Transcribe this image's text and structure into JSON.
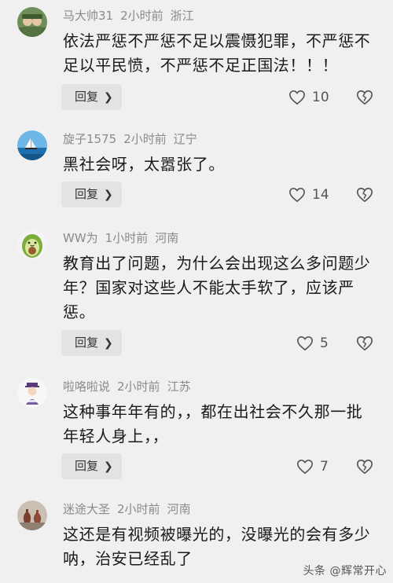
{
  "comments": [
    {
      "username": "马大帅31",
      "time": "2小时前",
      "location": "浙江",
      "avatar_icon": "soldiers-avatar-icon",
      "text": "依法严惩不严惩不足以震慑犯罪，不严惩不足以平民愤，不严惩不足正国法！！！",
      "reply_label": "回复",
      "likes": "10"
    },
    {
      "username": "旋子1575",
      "time": "2小时前",
      "location": "辽宁",
      "avatar_icon": "seascape-avatar-icon",
      "text": "黑社会呀，太嚣张了。",
      "reply_label": "回复",
      "likes": "14"
    },
    {
      "username": "WW为",
      "time": "1小时前",
      "location": "河南",
      "avatar_icon": "avocado-avatar-icon",
      "text": "教育出了问题，为什么会出现这么多问题少年？国家对这些人不能太手软了，应该严惩。",
      "reply_label": "回复",
      "likes": "5"
    },
    {
      "username": "啦咯啦说",
      "time": "2小时前",
      "location": "江苏",
      "avatar_icon": "cartoon-person-avatar-icon",
      "text": "这种事年年有的，，都在出社会不久那一批年轻人身上，，",
      "reply_label": "回复",
      "likes": "7"
    },
    {
      "username": "迷途大圣",
      "time": "2小时前",
      "location": "河南",
      "avatar_icon": "vases-avatar-icon",
      "text": "这还是有视频被曝光的，没曝光的会有多少呐，治安已经乱了",
      "reply_label": "回复",
      "likes": ""
    }
  ],
  "watermark": "头条 @辉常开心",
  "colors": {
    "background": "#f0f0f0",
    "username": "#8a8a8a",
    "text": "#1a1a1a",
    "reply_bg": "#e3e3e3"
  }
}
